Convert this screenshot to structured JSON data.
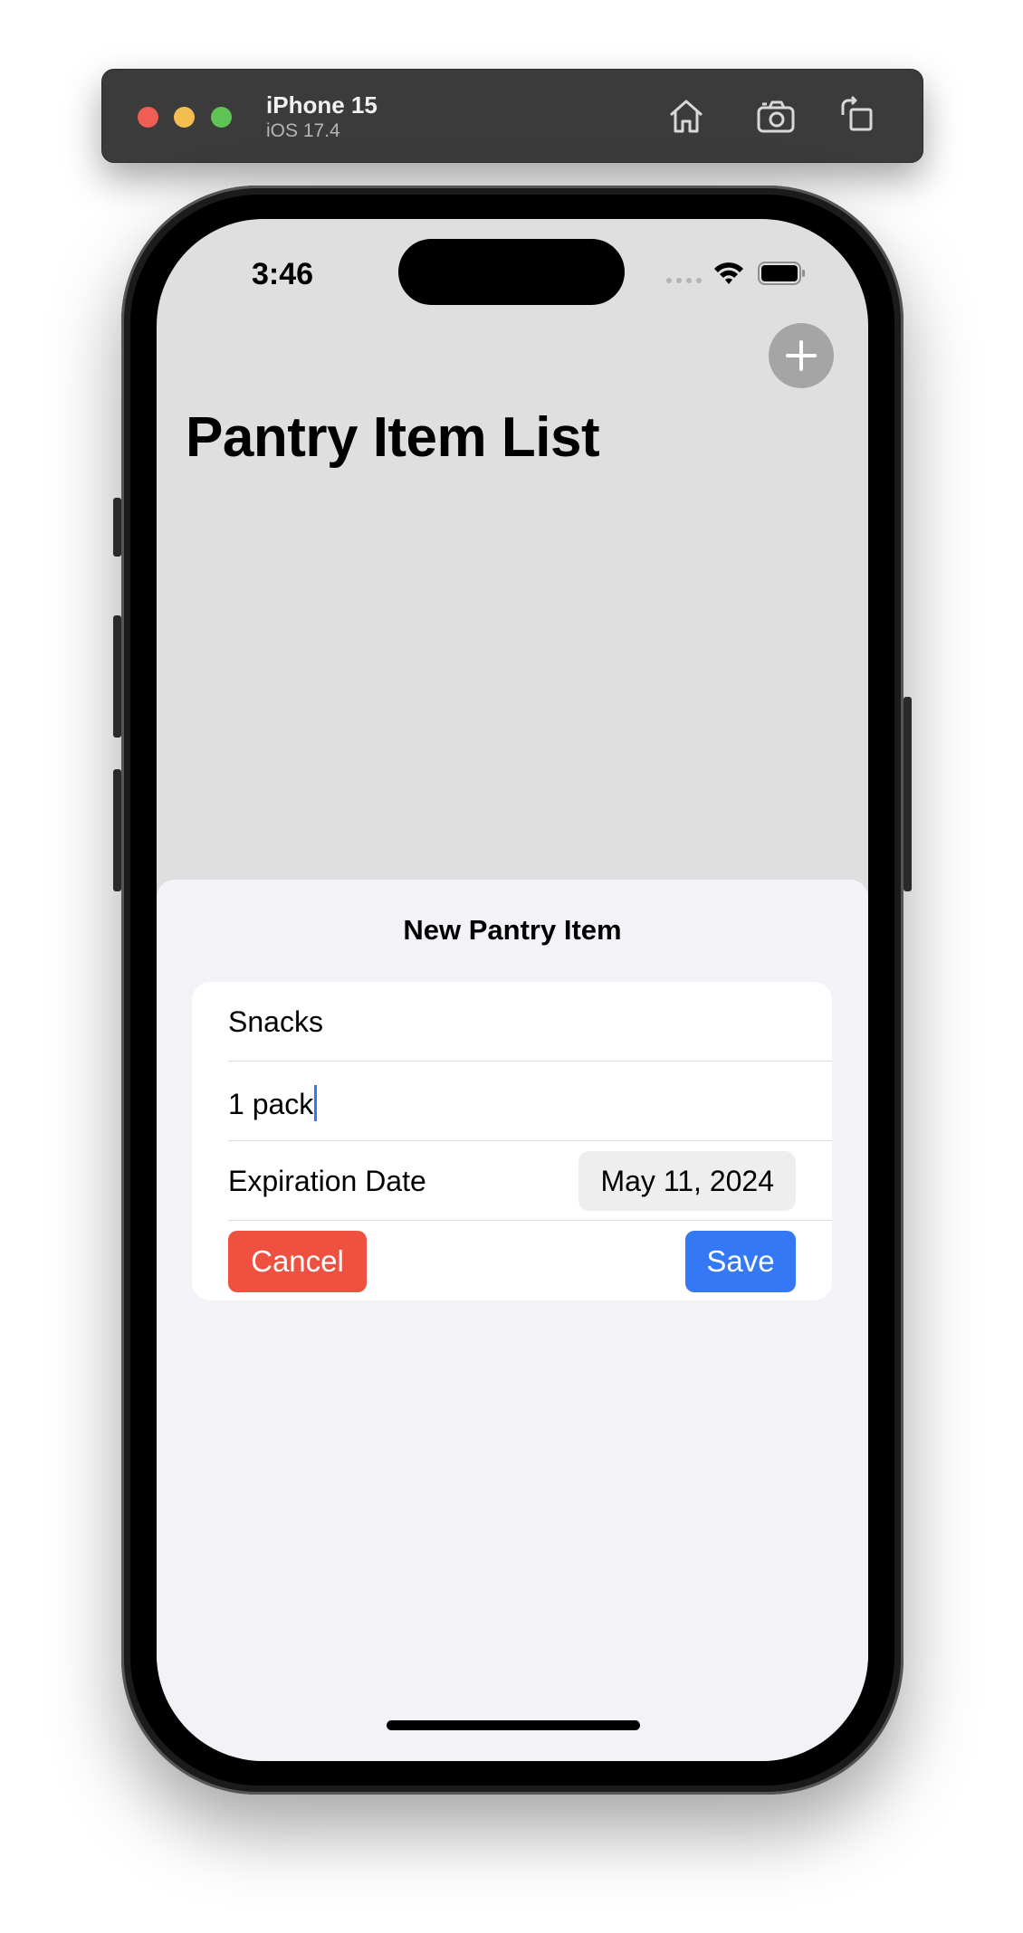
{
  "simulator": {
    "device_name": "iPhone 15",
    "os_version": "iOS 17.4",
    "icons": [
      "home-icon",
      "screenshot-icon",
      "rotate-icon"
    ]
  },
  "status_bar": {
    "time": "3:46",
    "icons": [
      "signal-dots-icon",
      "wifi-icon",
      "battery-icon"
    ]
  },
  "nav": {
    "title": "Pantry Item List",
    "add_icon": "plus-icon"
  },
  "sheet": {
    "title": "New Pantry Item",
    "name_field": "Snacks",
    "quantity_field": "1 pack",
    "expiration_label": "Expiration Date",
    "expiration_value": "May 11, 2024",
    "cancel_label": "Cancel",
    "save_label": "Save"
  },
  "colors": {
    "cancel": "#ee5140",
    "save": "#3478f6",
    "caret": "#3478f6",
    "dimmed_background": "#dfdfe0",
    "sheet_background": "#f2f2f7"
  }
}
